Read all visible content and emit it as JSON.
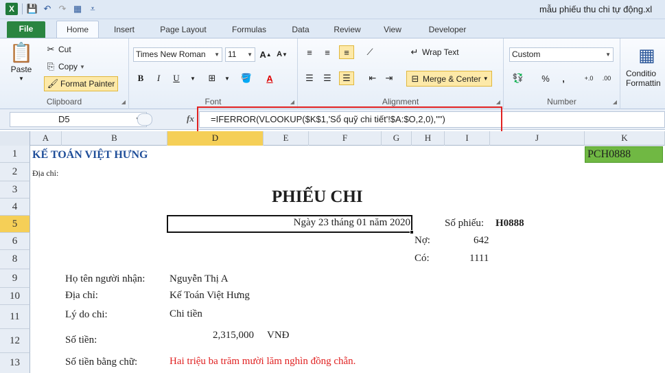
{
  "window": {
    "title": "mẫu phiếu thu chi tự động.xl"
  },
  "qat": {
    "logo": "X"
  },
  "tabs": [
    "File",
    "Home",
    "Insert",
    "Page Layout",
    "Formulas",
    "Data",
    "Review",
    "View",
    "Developer"
  ],
  "clipboard": {
    "paste": "Paste",
    "cut": "Cut",
    "copy": "Copy",
    "format_painter": "Format Painter",
    "label": "Clipboard"
  },
  "font": {
    "name": "Times New Roman",
    "size": "11",
    "bold": "B",
    "italic": "I",
    "underline": "U",
    "font_color_letter": "A",
    "grow": "A",
    "shrink": "A",
    "label": "Font"
  },
  "alignment": {
    "wrap_text": "Wrap Text",
    "merge_center": "Merge & Center",
    "label": "Alignment"
  },
  "number": {
    "format": "Custom",
    "percent": "%",
    "comma": ",",
    "inc_decimal": "+.0 .00",
    "dec_decimal": ".00 +.0",
    "label": "Number"
  },
  "styles": {
    "conditional": "Conditio",
    "formatting": "Formattin"
  },
  "formula_bar": {
    "name_box": "D5",
    "fx": "fx",
    "formula": "=IFERROR(VLOOKUP($K$1,'Sổ quỹ chi tiết'!$A:$O,2,0),\"\")"
  },
  "columns": [
    "A",
    "B",
    "D",
    "E",
    "F",
    "G",
    "H",
    "I",
    "J",
    "K"
  ],
  "rows": [
    "1",
    "2",
    "3",
    "4",
    "5",
    "6",
    "8",
    "9",
    "10",
    "11",
    "12",
    "13"
  ],
  "sheet": {
    "company": "KẾ TOÁN VIỆT HƯNG",
    "address_label": "Địa chỉ:",
    "k1": "PCH0888",
    "title": "PHIẾU CHI",
    "date": "Ngày 23 tháng 01 năm 2020",
    "voucher_label": "Số phiếu:",
    "voucher_no": "H0888",
    "debit_label": "Nợ:",
    "debit_value": "642",
    "credit_label": "Có:",
    "credit_value": "1111",
    "receiver_label": "Họ tên người nhận:",
    "receiver_value": "Nguyễn Thị A",
    "addr_label": "Địa chỉ:",
    "addr_value": "Kế Toán Việt Hưng",
    "reason_label": "Lý do chi:",
    "reason_value": "Chi tiền",
    "amount_label": "Số tiền:",
    "amount_value": "2,315,000",
    "amount_currency": "VNĐ",
    "words_label": "Số tiền bằng chữ:",
    "words_value": "Hai triệu ba trăm mười lăm nghìn đồng chẵn."
  },
  "colors": {
    "accent_green": "#2a8540",
    "company_blue": "#1f4e99",
    "k1_fill": "#70b843",
    "red_text": "#e02020",
    "selection": "#f5cf57"
  }
}
